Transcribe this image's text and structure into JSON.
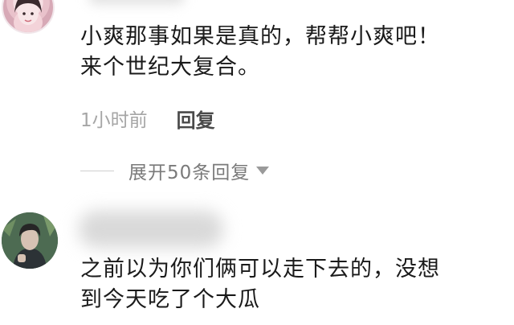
{
  "comments": [
    {
      "text_line1": "小爽那事如果是真的，帮帮小爽吧！",
      "text_line2": "来个世纪大复合。",
      "time": "1小时前",
      "reply_label": "回复",
      "expand_label": "展开50条回复"
    },
    {
      "text_line1": "之前以为你们俩可以走下去的，没想",
      "text_line2": "到今天吃了个大瓜"
    }
  ],
  "icons": {
    "expand": "chevron-down-icon"
  },
  "colors": {
    "text": "#1a1a1a",
    "muted": "#a6a6a6",
    "reply": "#4a4a4a",
    "expand": "#7a7a7a"
  }
}
